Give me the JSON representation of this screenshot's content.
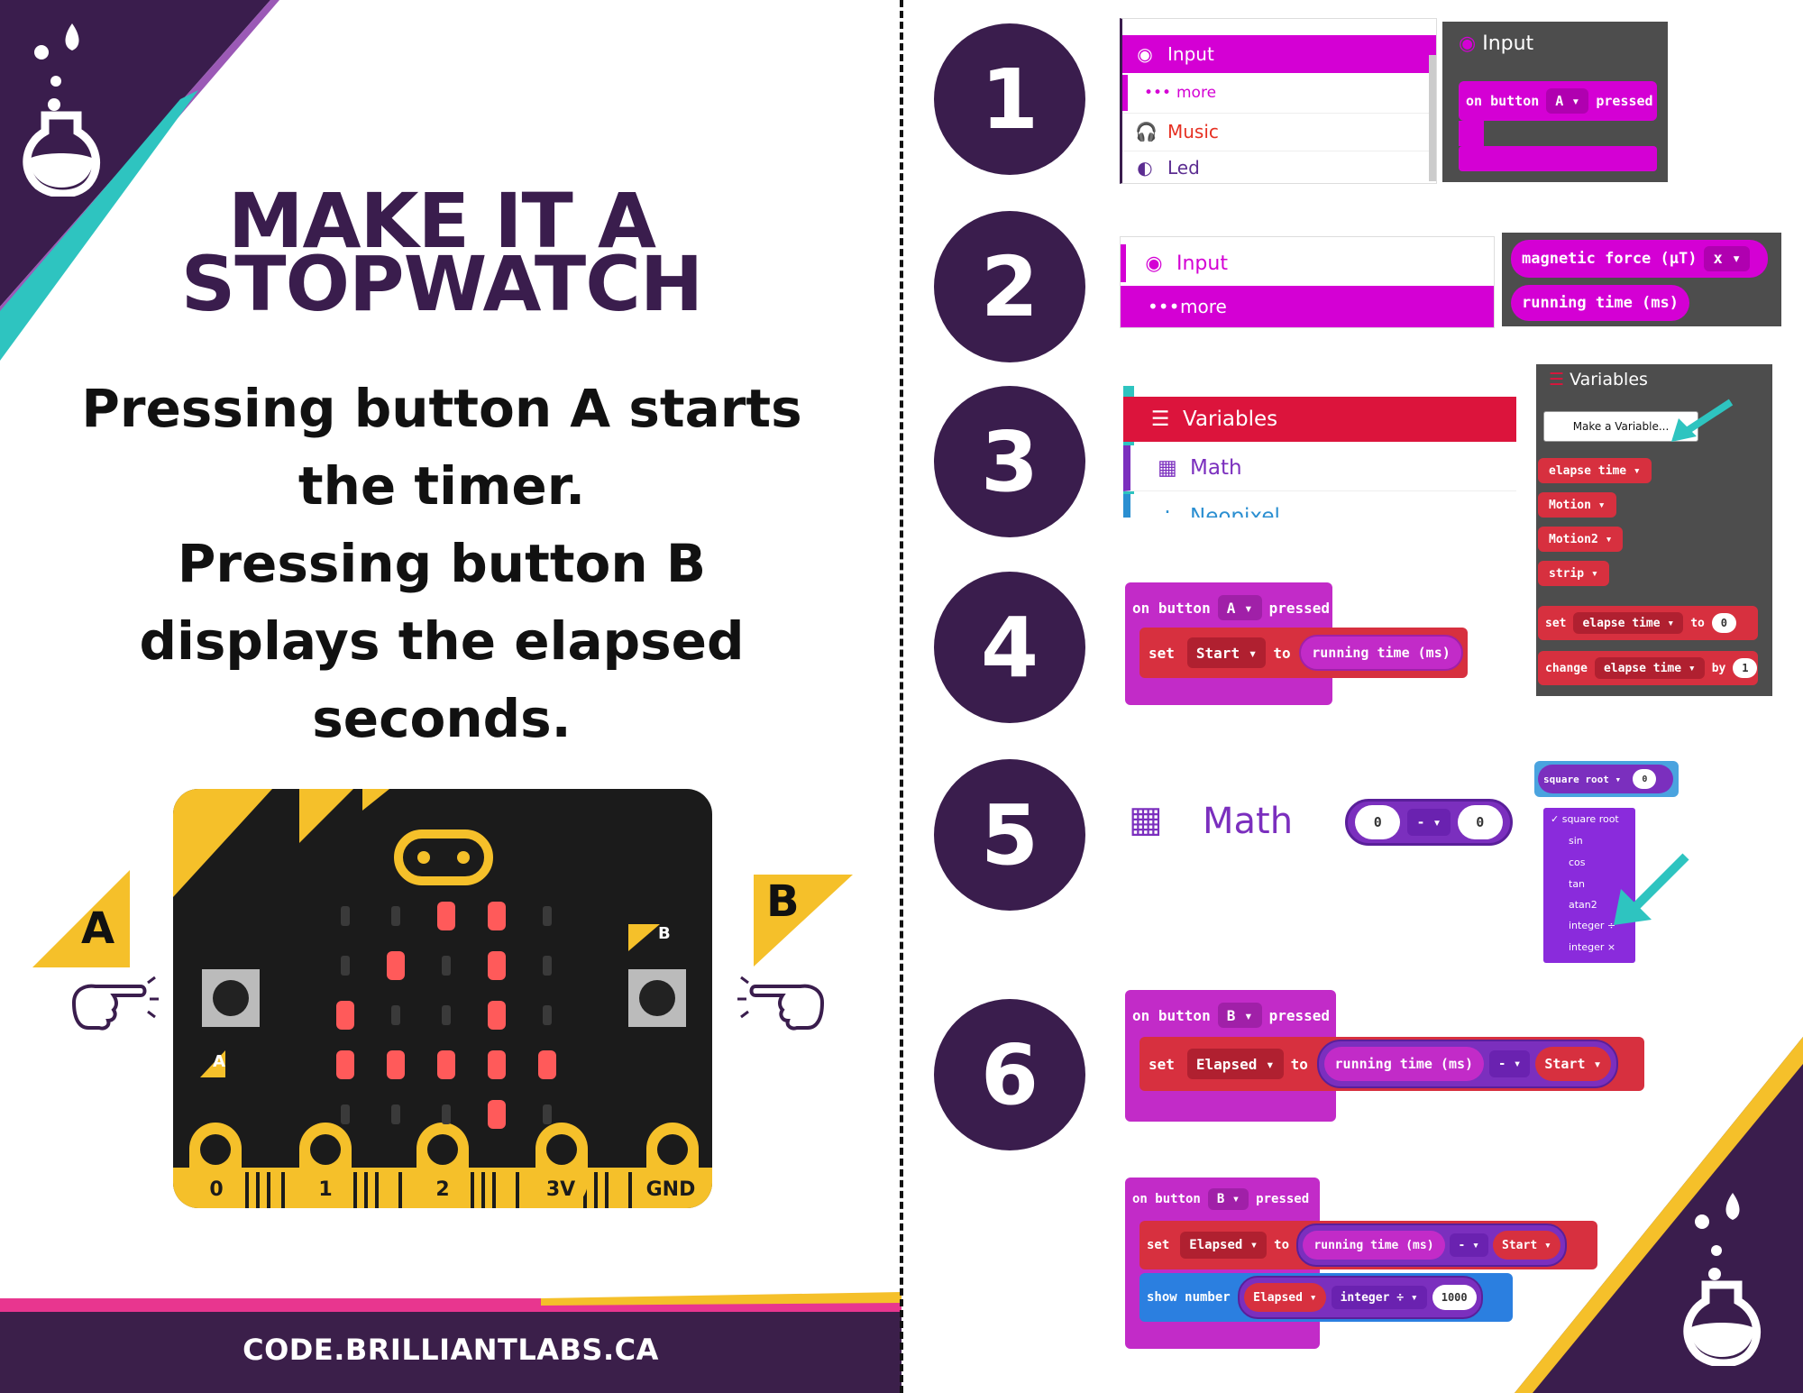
{
  "left": {
    "title_line1": "MAKE IT A",
    "title_line2": "STOPWATCH",
    "desc_line1": "Pressing button A starts",
    "desc_line2": "the timer.",
    "desc_line3": "Pressing button B",
    "desc_line4": "displays the elapsed",
    "desc_line5": "seconds.",
    "label_a": "A",
    "label_b": "B",
    "footer": "CODE.BRILLIANTLABS.CA",
    "board": {
      "btn_a": "A",
      "btn_b": "B",
      "pins": [
        "0",
        "1",
        "2",
        "3V",
        "GND"
      ]
    }
  },
  "steps": [
    "1",
    "2",
    "3",
    "4",
    "5",
    "6"
  ],
  "step1": {
    "menu": [
      "Input",
      "more",
      "Music",
      "Led"
    ],
    "flyout_title": "Input",
    "block_on": "on button",
    "block_btn": "A",
    "block_pressed": "pressed"
  },
  "step2": {
    "menu": [
      "Input",
      "more"
    ],
    "pill1": "magnetic force (µT)",
    "pill1_axis": "x",
    "pill2": "running time (ms)"
  },
  "step3": {
    "menu": [
      "Variables",
      "Math",
      "Neopixel"
    ],
    "flyout_title": "Variables",
    "make_var": "Make a Variable...",
    "vars": [
      "elapse time",
      "Motion",
      "Motion2",
      "strip"
    ],
    "set": "set",
    "set_var": "elapse time",
    "to": "to",
    "set_val": "0",
    "change": "change",
    "change_var": "elapse time",
    "by": "by",
    "change_val": "1"
  },
  "step4": {
    "on": "on button",
    "btn": "A",
    "pressed": "pressed",
    "set": "set",
    "var": "Start",
    "to": "to",
    "value": "running time (ms)"
  },
  "step5": {
    "math": "Math",
    "left": "0",
    "op": "-",
    "right": "0",
    "sq_label": "square root",
    "sq_val": "0",
    "options": [
      "square root",
      "sin",
      "cos",
      "tan",
      "atan2",
      "integer ÷",
      "integer ×"
    ]
  },
  "step6a": {
    "on": "on button",
    "btn": "B",
    "pressed": "pressed",
    "set": "set",
    "var": "Elapsed",
    "to": "to",
    "value": "running time (ms)",
    "op": "-",
    "var2": "Start"
  },
  "step6b": {
    "on": "on button",
    "btn": "B",
    "pressed": "pressed",
    "set": "set",
    "var": "Elapsed",
    "to": "to",
    "value": "running time (ms)",
    "op": "-",
    "var2": "Start",
    "show": "show number",
    "show_var": "Elapsed",
    "div": "integer ÷",
    "div_val": "1000"
  },
  "colors": {
    "purple_dark": "#3a1d4d",
    "teal": "#2ec4c0",
    "yellow": "#f5c02a",
    "pink": "#e8368f",
    "magenta": "#d400d4",
    "block_purple": "#c22bc8",
    "block_red": "#d7303f"
  }
}
